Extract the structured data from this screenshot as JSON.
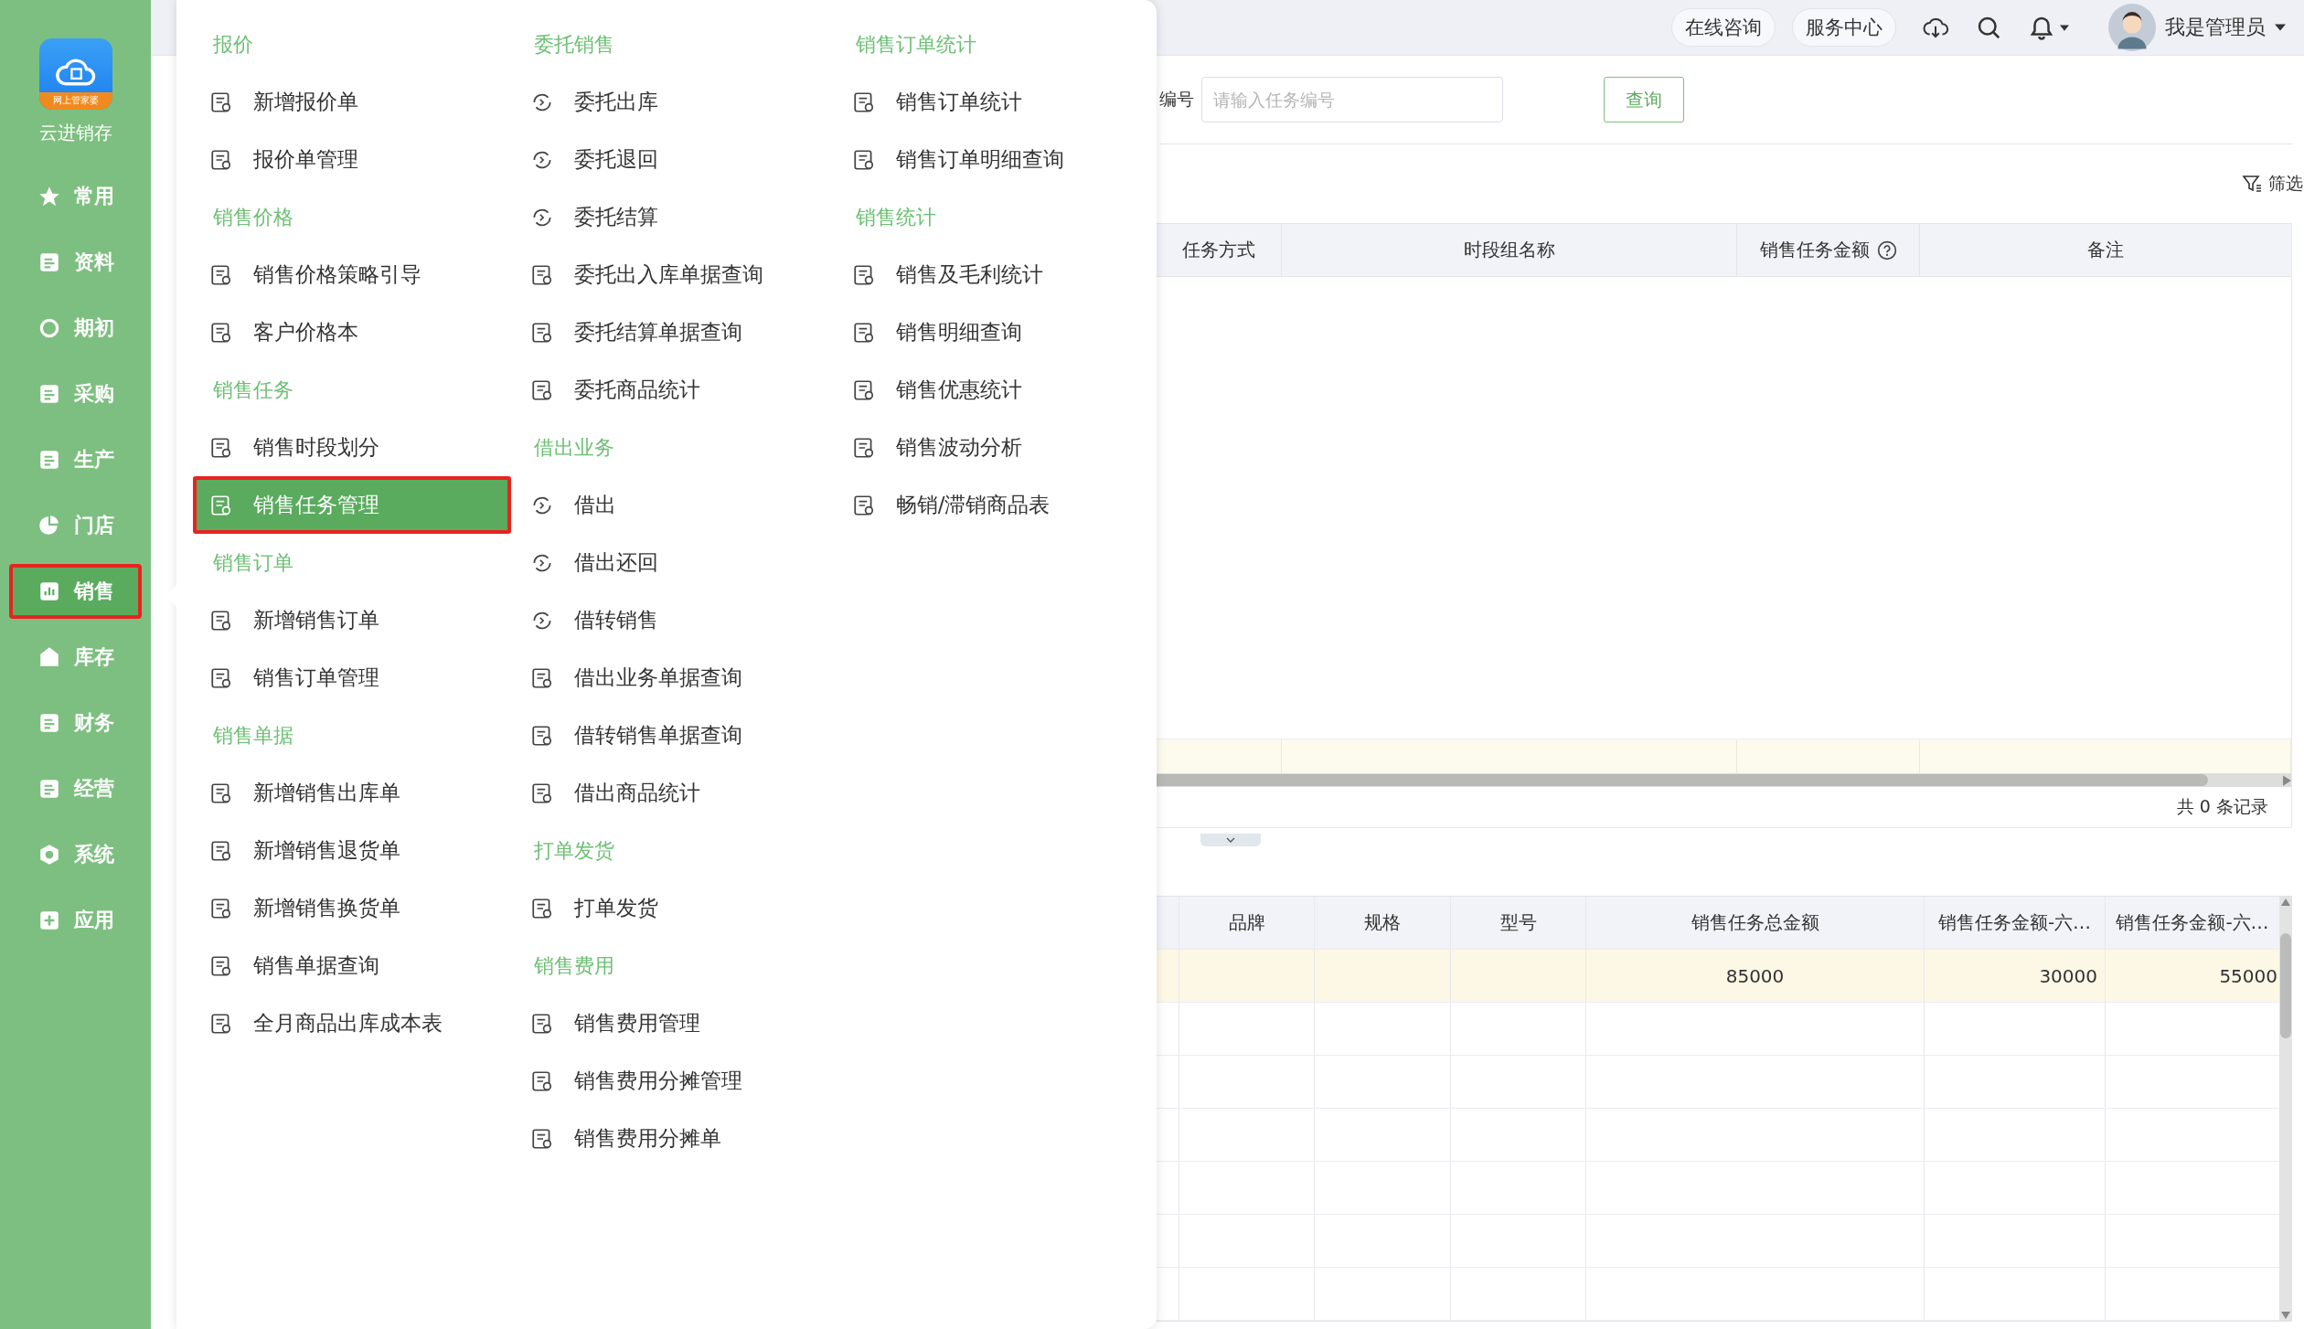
{
  "sidebar": {
    "logo_badge": "网上管家婆",
    "app_name": "云进销存",
    "items": [
      {
        "label": "常用",
        "selected": false
      },
      {
        "label": "资料",
        "selected": false
      },
      {
        "label": "期初",
        "selected": false
      },
      {
        "label": "采购",
        "selected": false
      },
      {
        "label": "生产",
        "selected": false
      },
      {
        "label": "门店",
        "selected": false
      },
      {
        "label": "销售",
        "selected": true
      },
      {
        "label": "库存",
        "selected": false
      },
      {
        "label": "财务",
        "selected": false
      },
      {
        "label": "经营",
        "selected": false
      },
      {
        "label": "系统",
        "selected": false
      },
      {
        "label": "应用",
        "selected": false
      }
    ]
  },
  "top_bar": {
    "buttons": [
      "在线咨询",
      "服务中心"
    ],
    "user": "我是管理员"
  },
  "query": {
    "label": "编号",
    "placeholder": "请输入任务编号",
    "button": "查询"
  },
  "filter": "筛选",
  "task_table": {
    "columns": [
      {
        "label": "任务方式",
        "help": false
      },
      {
        "label": "时段组名称",
        "help": false
      },
      {
        "label": "销售任务金额",
        "help": true
      },
      {
        "label": "备注",
        "help": false
      }
    ],
    "footer": "共 0 条记录"
  },
  "detail_table": {
    "columns": [
      "",
      "品牌",
      "规格",
      "型号",
      "销售任务总金额",
      "销售任务金额-六…",
      "销售任务金额-六…"
    ],
    "rows": [
      {
        "selected": true,
        "cells": [
          null,
          null,
          null,
          null,
          "85000",
          "30000",
          "55000"
        ]
      }
    ]
  },
  "menu": {
    "columns": [
      [
        {
          "title": "报价",
          "items": [
            {
              "label": "新增报价单",
              "selected": false
            },
            {
              "label": "报价单管理",
              "selected": false
            }
          ]
        },
        {
          "title": "销售价格",
          "items": [
            {
              "label": "销售价格策略引导",
              "selected": false
            },
            {
              "label": "客户价格本",
              "selected": false
            }
          ]
        },
        {
          "title": "销售任务",
          "items": [
            {
              "label": "销售时段划分",
              "selected": false
            },
            {
              "label": "销售任务管理",
              "selected": true
            }
          ]
        },
        {
          "title": "销售订单",
          "items": [
            {
              "label": "新增销售订单",
              "selected": false
            },
            {
              "label": "销售订单管理",
              "selected": false
            }
          ]
        },
        {
          "title": "销售单据",
          "items": [
            {
              "label": "新增销售出库单",
              "selected": false
            },
            {
              "label": "新增销售退货单",
              "selected": false
            },
            {
              "label": "新增销售换货单",
              "selected": false
            },
            {
              "label": "销售单据查询",
              "selected": false
            },
            {
              "label": "全月商品出库成本表",
              "selected": false
            }
          ]
        }
      ],
      [
        {
          "title": "委托销售",
          "items": [
            {
              "label": "委托出库",
              "selected": false
            },
            {
              "label": "委托退回",
              "selected": false
            },
            {
              "label": "委托结算",
              "selected": false
            },
            {
              "label": "委托出入库单据查询",
              "selected": false
            },
            {
              "label": "委托结算单据查询",
              "selected": false
            },
            {
              "label": "委托商品统计",
              "selected": false
            }
          ]
        },
        {
          "title": "借出业务",
          "items": [
            {
              "label": "借出",
              "selected": false
            },
            {
              "label": "借出还回",
              "selected": false
            },
            {
              "label": "借转销售",
              "selected": false
            },
            {
              "label": "借出业务单据查询",
              "selected": false
            },
            {
              "label": "借转销售单据查询",
              "selected": false
            },
            {
              "label": "借出商品统计",
              "selected": false
            }
          ]
        },
        {
          "title": "打单发货",
          "items": [
            {
              "label": "打单发货",
              "selected": false
            }
          ]
        },
        {
          "title": "销售费用",
          "items": [
            {
              "label": "销售费用管理",
              "selected": false
            },
            {
              "label": "销售费用分摊管理",
              "selected": false
            },
            {
              "label": "销售费用分摊单",
              "selected": false
            }
          ]
        }
      ],
      [
        {
          "title": "销售订单统计",
          "items": [
            {
              "label": "销售订单统计",
              "selected": false
            },
            {
              "label": "销售订单明细查询",
              "selected": false
            }
          ]
        },
        {
          "title": "销售统计",
          "items": [
            {
              "label": "销售及毛利统计",
              "selected": false
            },
            {
              "label": "销售明细查询",
              "selected": false
            },
            {
              "label": "销售优惠统计",
              "selected": false
            },
            {
              "label": "销售波动分析",
              "selected": false
            },
            {
              "label": "畅销/滞销商品表",
              "selected": false
            }
          ]
        }
      ]
    ]
  }
}
